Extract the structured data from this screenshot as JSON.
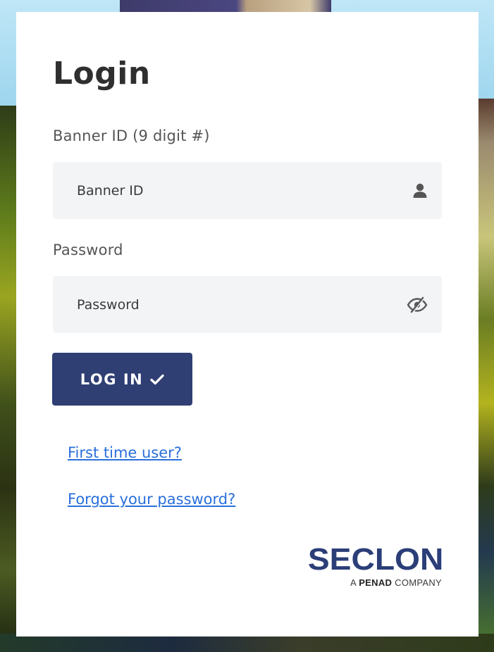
{
  "login": {
    "title": "Login",
    "banner_id": {
      "label": "Banner ID (9 digit #)",
      "placeholder": "Banner ID",
      "value": "",
      "icon": "user-icon"
    },
    "password": {
      "label": "Password",
      "placeholder": "Password",
      "value": "",
      "icon": "eye-slash-icon"
    },
    "login_button": {
      "label": "LOG IN",
      "icon": "check-icon"
    },
    "links": {
      "first_time": "First time user?",
      "forgot_password": "Forgot your password?"
    }
  },
  "branding": {
    "name": "SECLON",
    "tagline_prefix": "A",
    "tagline_bold": "PENAD",
    "tagline_suffix": "COMPANY"
  },
  "colors": {
    "primary_button": "#2f3e73",
    "link": "#2a6fda",
    "brand": "#2b3e78",
    "input_bg": "#f3f4f6"
  }
}
